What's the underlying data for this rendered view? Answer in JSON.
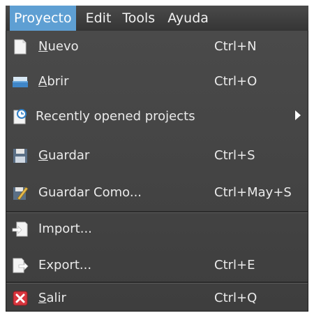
{
  "menubar": {
    "items": [
      {
        "label": "Proyecto"
      },
      {
        "label": "Edit"
      },
      {
        "label": "Tools"
      },
      {
        "label": "Ayuda"
      }
    ]
  },
  "menu": {
    "items": [
      {
        "label": "Nuevo",
        "shortcut": "Ctrl+N",
        "icon": "new-document-icon"
      },
      {
        "label": "Abrir",
        "shortcut": "Ctrl+O",
        "icon": "open-folder-icon"
      },
      {
        "label": "Recently opened projects",
        "shortcut": "",
        "icon": "recent-projects-icon",
        "submenu": true
      },
      {
        "label": "Guardar",
        "shortcut": "Ctrl+S",
        "icon": "save-disk-icon"
      },
      {
        "label": "Guardar Como...",
        "shortcut": "Ctrl+May+S",
        "icon": "save-as-icon"
      },
      {
        "label": "Import...",
        "shortcut": "",
        "icon": "import-icon"
      },
      {
        "label": "Export...",
        "shortcut": "Ctrl+E",
        "icon": "export-icon"
      },
      {
        "label": "Salir",
        "shortcut": "Ctrl+Q",
        "icon": "exit-icon"
      }
    ]
  },
  "colors": {
    "menu_background": "#3f3f3f",
    "active_item": "#5e9fd3",
    "text": "#eaeaea"
  }
}
